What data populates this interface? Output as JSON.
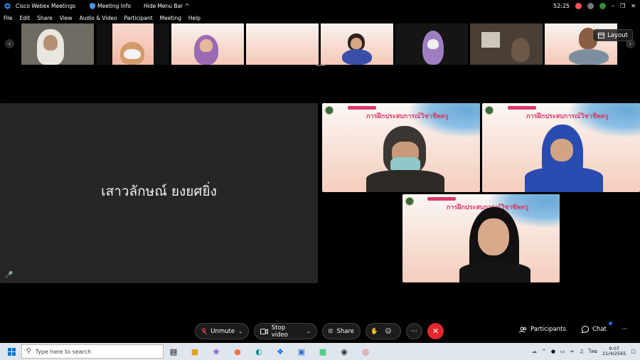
{
  "titlebar": {
    "app_title": "Cisco Webex Meetings",
    "meeting_info": "Meeting Info",
    "hide_menu": "Hide Menu Bar",
    "timer": "52:25",
    "chevron": "^"
  },
  "menu": [
    "File",
    "Edit",
    "Share",
    "View",
    "Audio & Video",
    "Participant",
    "Meeting",
    "Help"
  ],
  "layout_label": "Layout",
  "main": {
    "big_name": "เสาวลักษณ์ ยงยศยิ่ง",
    "slide_title": "การฝึกประสบการณ์วิชาชีพครู"
  },
  "controls": {
    "unmute": "Unmute",
    "stop_video": "Stop video",
    "share": "Share",
    "participants": "Participants",
    "chat": "Chat",
    "more": "···"
  },
  "taskbar": {
    "search_placeholder": "Type here to search",
    "lang": "ไทย",
    "time": "9:07",
    "date": "21/4/2565"
  },
  "colors": {
    "end_button": "#e3272f",
    "slide_title": "#d93a6a",
    "accent_blue": "#1a73e8"
  }
}
